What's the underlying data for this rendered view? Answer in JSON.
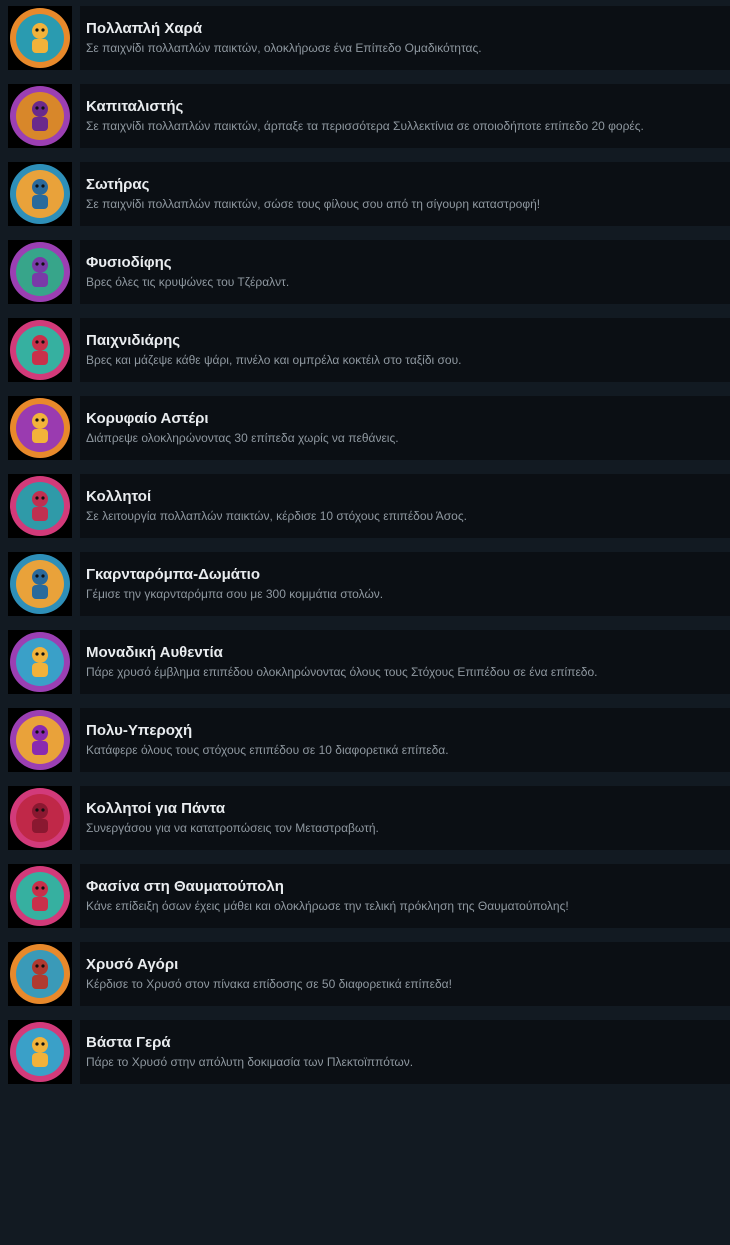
{
  "achievements": [
    {
      "title": "Πολλαπλή Χαρά",
      "desc": "Σε παιχνίδι πολλαπλών παικτών, ολοκλήρωσε ένα Επίπεδο Ομαδικότητας.",
      "icon": "multiplayer-joy-badge-icon",
      "ring": "#e8892b",
      "fill": "#2a9bb0",
      "glyph": "#f2b23a"
    },
    {
      "title": "Καπιταλιστής",
      "desc": "Σε παιχνίδι πολλαπλών παικτών, άρπαξε τα περισσότερα Συλλεκτίνια σε οποιοδήποτε επίπεδο 20 φορές.",
      "icon": "capitalist-badge-icon",
      "ring": "#9b3fb3",
      "fill": "#d8872a",
      "glyph": "#6a2a8c"
    },
    {
      "title": "Σωτήρας",
      "desc": "Σε παιχνίδι πολλαπλών παικτών, σώσε τους φίλους σου από τη σίγουρη καταστροφή!",
      "icon": "savior-badge-icon",
      "ring": "#2e8fb8",
      "fill": "#e9a23a",
      "glyph": "#2a6a9c"
    },
    {
      "title": "Φυσιοδίφης",
      "desc": "Βρες όλες τις κρυψώνες του Τζέραλντ.",
      "icon": "naturalist-badge-icon",
      "ring": "#9b3fb3",
      "fill": "#37a58a",
      "glyph": "#7a3aa8"
    },
    {
      "title": "Παιχνιδιάρης",
      "desc": "Βρες και μάζεψε κάθε ψάρι, πινέλο και ομπρέλα κοκτέιλ στο ταξίδι σου.",
      "icon": "playful-badge-icon",
      "ring": "#d23a7a",
      "fill": "#36b0a0",
      "glyph": "#c9304a"
    },
    {
      "title": "Κορυφαίο Αστέρι",
      "desc": "Διάπρεψε ολοκληρώνοντας 30 επίπεδα χωρίς να πεθάνεις.",
      "icon": "top-star-badge-icon",
      "ring": "#e8892b",
      "fill": "#9a3bb0",
      "glyph": "#f2b23a"
    },
    {
      "title": "Κολλητοί",
      "desc": "Σε λειτουργία πολλαπλών παικτών, κέρδισε 10 στόχους επιπέδου Άσος.",
      "icon": "buddies-badge-icon",
      "ring": "#d23a7a",
      "fill": "#2f9aa8",
      "glyph": "#c03050"
    },
    {
      "title": "Γκαρνταρόμπα-Δωμάτιο",
      "desc": "Γέμισε την γκαρνταρόμπα σου με 300 κομμάτια στολών.",
      "icon": "wardrobe-room-badge-icon",
      "ring": "#2e8fb8",
      "fill": "#e9a23a",
      "glyph": "#2a6a9c"
    },
    {
      "title": "Μοναδική Αυθεντία",
      "desc": "Πάρε χρυσό έμβλημα επιπέδου ολοκληρώνοντας όλους τους Στόχους Επιπέδου σε ένα επίπεδο.",
      "icon": "unique-authority-badge-icon",
      "ring": "#9b3fb3",
      "fill": "#3aa0c8",
      "glyph": "#f2b23a"
    },
    {
      "title": "Πολυ-Υπεροχή",
      "desc": "Κατάφερε όλους τους στόχους επιπέδου σε 10 διαφορετικά επίπεδα.",
      "icon": "multi-excellence-badge-icon",
      "ring": "#9b3fb3",
      "fill": "#e9a23a",
      "glyph": "#8a2ab0"
    },
    {
      "title": "Κολλητοί για Πάντα",
      "desc": "Συνεργάσου για να κατατροπώσεις τον Μεταστραβωτή.",
      "icon": "buddies-forever-badge-icon",
      "ring": "#d23a7a",
      "fill": "#c02848",
      "glyph": "#8a1830"
    },
    {
      "title": "Φασίνα στη Θαυματούπολη",
      "desc": "Κάνε επίδειξη όσων έχεις μάθει και ολοκλήρωσε την τελική πρόκληση της Θαυματούπολης!",
      "icon": "wonderland-cleanup-badge-icon",
      "ring": "#d23a7a",
      "fill": "#36b0a0",
      "glyph": "#c9304a"
    },
    {
      "title": "Χρυσό Αγόρι",
      "desc": "Κέρδισε το Χρυσό στον πίνακα επίδοσης σε 50 διαφορετικά επίπεδα!",
      "icon": "golden-boy-badge-icon",
      "ring": "#e8892b",
      "fill": "#3a9ab8",
      "glyph": "#b03a30"
    },
    {
      "title": "Βάστα Γερά",
      "desc": "Πάρε το Χρυσό στην απόλυτη δοκιμασία των Πλεκτοϊππότων.",
      "icon": "hold-tight-badge-icon",
      "ring": "#d23a7a",
      "fill": "#3aa0c8",
      "glyph": "#f2b23a"
    }
  ]
}
